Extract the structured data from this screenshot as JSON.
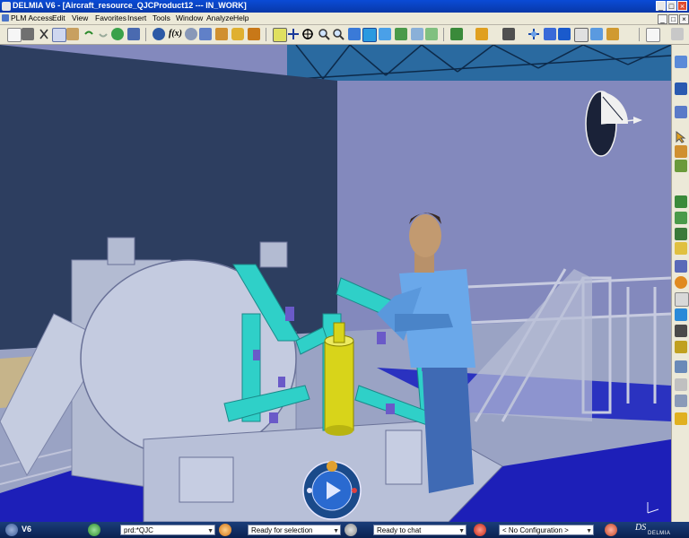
{
  "window": {
    "title": "DELMIA V6 - [Aircraft_resource_QJCProduct12 --- IN_WORK]",
    "controls": [
      "_",
      "□",
      "×"
    ]
  },
  "menu": {
    "items": [
      "PLM Access",
      "Edit",
      "View",
      "Favorites",
      "Insert",
      "Tools",
      "Window",
      "Analyze",
      "Help"
    ]
  },
  "toolbar": {
    "icons": [
      "new-icon",
      "print-icon",
      "cut-icon",
      "copy-icon",
      "paste-icon",
      "undo-icon",
      "redo-icon",
      "what's-this-icon",
      "fly-icon",
      "fx-icon",
      "catalog-icon",
      "layers-icon",
      "bookmark-icon",
      "lock-icon",
      "publish-icon",
      "fit-all-icon",
      "pan-icon",
      "rotate-icon",
      "zoom-in-icon",
      "zoom-out-icon",
      "normal-view-icon",
      "iso-view-icon",
      "render-style-icon",
      "hide-show-icon",
      "swap-icon",
      "simulation-icon",
      "folder-icon",
      "camera-icon",
      "compass-icon",
      "measure-icon",
      "annotation-icon",
      "snap-icon",
      "help-icon"
    ]
  },
  "status": {
    "app_label": "V6",
    "prd_field": "prd:*QJC",
    "selection_status": "Ready for selection",
    "chat_status": "Ready to chat",
    "configuration": "< No Configuration >",
    "brand": "DS",
    "brand_sub": "DELMIA"
  },
  "colors": {
    "title_bar": "#0a4bd6",
    "status_bar": "#0a2150",
    "viewport_wall": "#7f86b8",
    "fixture_cyan": "#2fd0c8",
    "fixture_yellow": "#d8d41a",
    "floor_blue": "#1d1fb8"
  }
}
